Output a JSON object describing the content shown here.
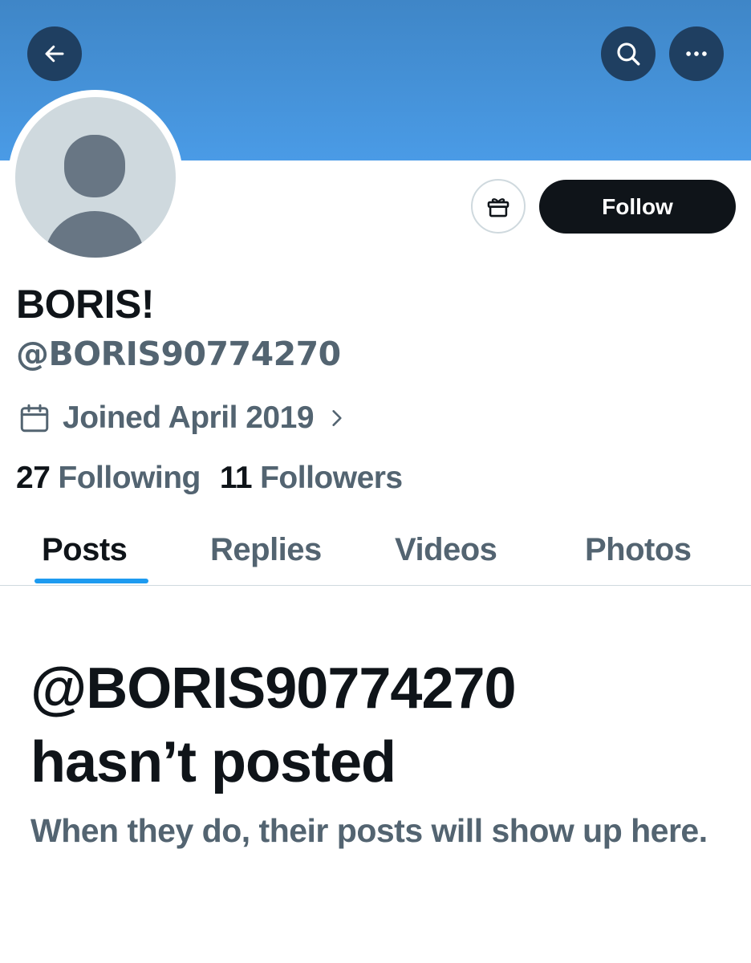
{
  "header": {
    "back_icon": "arrow-left-icon",
    "search_icon": "search-icon",
    "more_icon": "more-horizontal-icon",
    "banner_color": "#4a9be6"
  },
  "profile": {
    "display_name": "BORIS!",
    "handle": "@BORIS90774270",
    "joined": "Joined April 2019",
    "following_count": "27",
    "following_label": "Following",
    "followers_count": "11",
    "followers_label": "Followers",
    "follow_label": "Follow",
    "gift_icon": "gift-icon"
  },
  "tabs": [
    {
      "label": "Posts",
      "active": true
    },
    {
      "label": "Replies",
      "active": false
    },
    {
      "label": "Videos",
      "active": false
    },
    {
      "label": "Photos",
      "active": false
    }
  ],
  "empty_state": {
    "title_line1": "@BORIS90774270",
    "title_line2": "hasn’t posted",
    "subtitle": "When they do, their posts will show up here."
  },
  "colors": {
    "accent": "#1d9bf0",
    "text_primary": "#0f1419",
    "text_secondary": "#536471"
  }
}
